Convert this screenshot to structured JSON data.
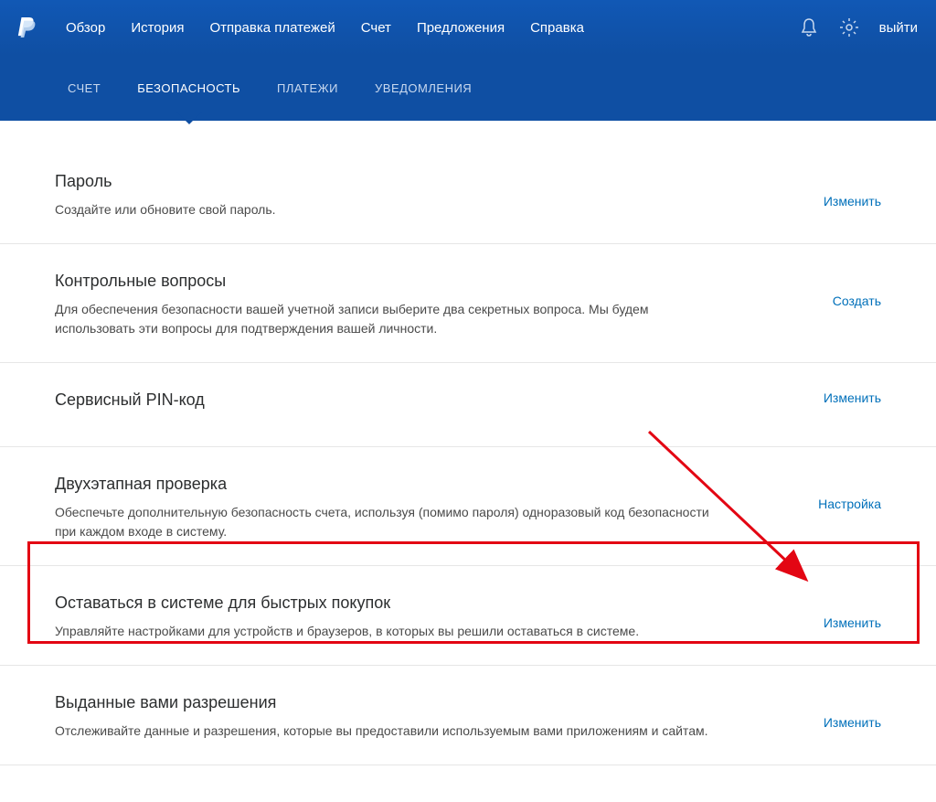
{
  "header": {
    "nav": [
      "Обзор",
      "История",
      "Отправка платежей",
      "Счет",
      "Предложения",
      "Справка"
    ],
    "logout": "выйти"
  },
  "subnav": {
    "items": [
      "СЧЕТ",
      "БЕЗОПАСНОСТЬ",
      "ПЛАТЕЖИ",
      "УВЕДОМЛЕНИЯ"
    ],
    "activeIndex": 1
  },
  "sections": [
    {
      "title": "Пароль",
      "desc": "Создайте или обновите свой пароль.",
      "action": "Изменить"
    },
    {
      "title": "Контрольные вопросы",
      "desc": "Для обеспечения безопасности вашей учетной записи выберите два секретных вопроса. Мы будем использовать эти вопросы для подтверждения вашей личности.",
      "action": "Создать"
    },
    {
      "title": "Сервисный PIN-код",
      "desc": "",
      "action": "Изменить"
    },
    {
      "title": "Двухэтапная проверка",
      "desc": "Обеспечьте дополнительную безопасность счета, используя (помимо пароля) одноразовый код безопасности при каждом входе в систему.",
      "action": "Настройка"
    },
    {
      "title": "Оставаться в системе для быстрых покупок",
      "desc": "Управляйте настройками для устройств и браузеров, в которых вы решили оставаться в системе.",
      "action": "Изменить"
    },
    {
      "title": "Выданные вами разрешения",
      "desc": "Отслеживайте данные и разрешения, которые вы предоставили используемым вами приложениям и сайтам.",
      "action": "Изменить"
    }
  ]
}
